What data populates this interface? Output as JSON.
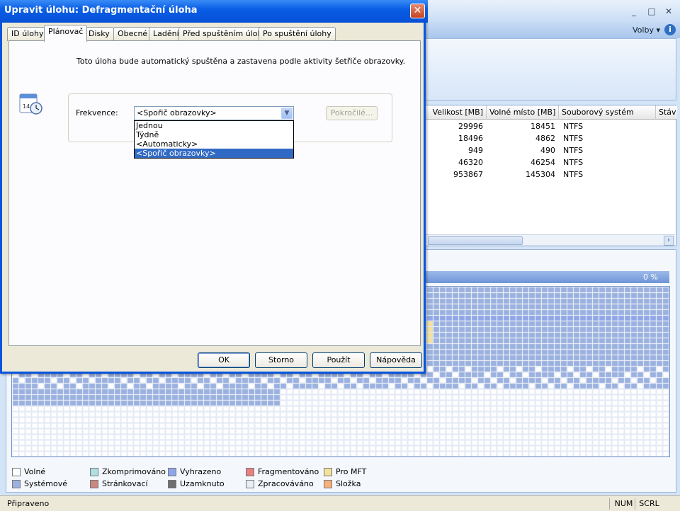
{
  "main_window": {
    "title_buttons": {
      "minimize": "_",
      "maximize": "□",
      "close": "✕"
    },
    "volby_label": "Volby",
    "table": {
      "columns": [
        "Velikost [MB]",
        "Volné místo [MB]",
        "Souborový systém",
        "Stáv"
      ],
      "rows": [
        {
          "size": "29996",
          "free": "18451",
          "fs": "NTFS"
        },
        {
          "size": "18496",
          "free": "4862",
          "fs": "NTFS"
        },
        {
          "size": "949",
          "free": "490",
          "fs": "NTFS"
        },
        {
          "size": "46320",
          "free": "46254",
          "fs": "NTFS"
        },
        {
          "size": "953867",
          "free": "145304",
          "fs": "NTFS"
        }
      ]
    },
    "progress_text": "0 %",
    "legend": [
      {
        "label": "Volné",
        "color": "#ffffff"
      },
      {
        "label": "Zkomprimováno",
        "color": "#aee0e4"
      },
      {
        "label": "Vyhrazeno",
        "color": "#8fa6e8"
      },
      {
        "label": "Fragmentováno",
        "color": "#e88080"
      },
      {
        "label": "Pro MFT",
        "color": "#f4e19a"
      },
      {
        "label": "Systémové",
        "color": "#9bb1e0"
      },
      {
        "label": "Stránkovací",
        "color": "#c98880"
      },
      {
        "label": "Uzamknuto",
        "color": "#6e6e6e"
      },
      {
        "label": "Zpracováváno",
        "color": "#e8eef6"
      },
      {
        "label": "Složka",
        "color": "#f7b07a"
      }
    ],
    "status": {
      "text": "Připraveno",
      "num": "NUM",
      "scrl": "SCRL"
    }
  },
  "dialog": {
    "title": "Upravit úlohu: Defragmentační úloha",
    "close": "✕",
    "tabs": [
      "ID úlohy",
      "Plánovač",
      "Disky",
      "Obecné",
      "Ladění",
      "Před spuštěním úlohy",
      "Po spuštění úlohy"
    ],
    "active_tab": "Plánovač",
    "info_text": "Toto úloha bude automatický spuštěna a zastavena podle aktivity šetřiče obrazovky.",
    "frequency_label": "Frekvence:",
    "frequency_value": "<Spořič obrazovky>",
    "frequency_options": [
      "Jednou",
      "Týdně",
      "<Automaticky>",
      "<Spořič obrazovky>"
    ],
    "advanced_button": "Pokročilé...",
    "calendar_number": "14",
    "buttons": {
      "ok": "OK",
      "cancel": "Storno",
      "apply": "Použít",
      "help": "Nápověda"
    }
  }
}
